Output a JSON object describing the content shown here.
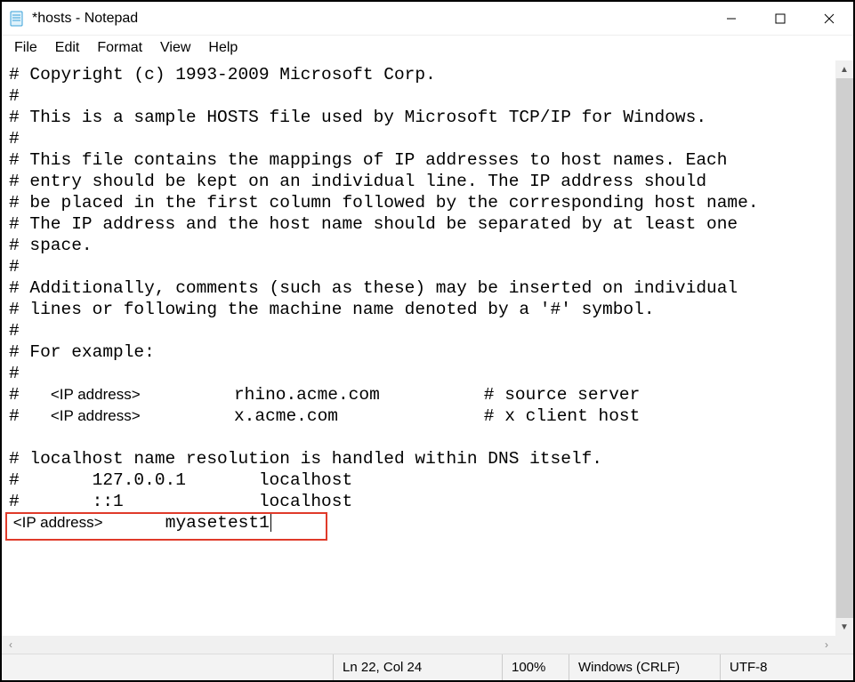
{
  "window": {
    "title": "*hosts - Notepad"
  },
  "menu": {
    "items": [
      "File",
      "Edit",
      "Format",
      "View",
      "Help"
    ]
  },
  "editor": {
    "lines": [
      "# Copyright (c) 1993-2009 Microsoft Corp.",
      "#",
      "# This is a sample HOSTS file used by Microsoft TCP/IP for Windows.",
      "#",
      "# This file contains the mappings of IP addresses to host names. Each",
      "# entry should be kept on an individual line. The IP address should",
      "# be placed in the first column followed by the corresponding host name.",
      "# The IP address and the host name should be separated by at least one",
      "# space.",
      "#",
      "# Additionally, comments (such as these) may be inserted on individual",
      "# lines or following the machine name denoted by a '#' symbol.",
      "#",
      "# For example:",
      "#"
    ],
    "example1": {
      "prefix": "#   ",
      "ip": "<IP address>",
      "host": "         rhino.acme.com          # source server"
    },
    "example2": {
      "prefix": "#   ",
      "ip": "<IP address>",
      "host": "         x.acme.com              # x client host"
    },
    "tail": [
      "",
      "# localhost name resolution is handled within DNS itself.",
      "#       127.0.0.1       localhost",
      "#       ::1             localhost"
    ],
    "entry": {
      "ip": " <IP address>",
      "host": "      myasetest1"
    }
  },
  "status": {
    "position": "Ln 22, Col 24",
    "zoom": "100%",
    "line_ending": "Windows (CRLF)",
    "encoding": "UTF-8"
  }
}
